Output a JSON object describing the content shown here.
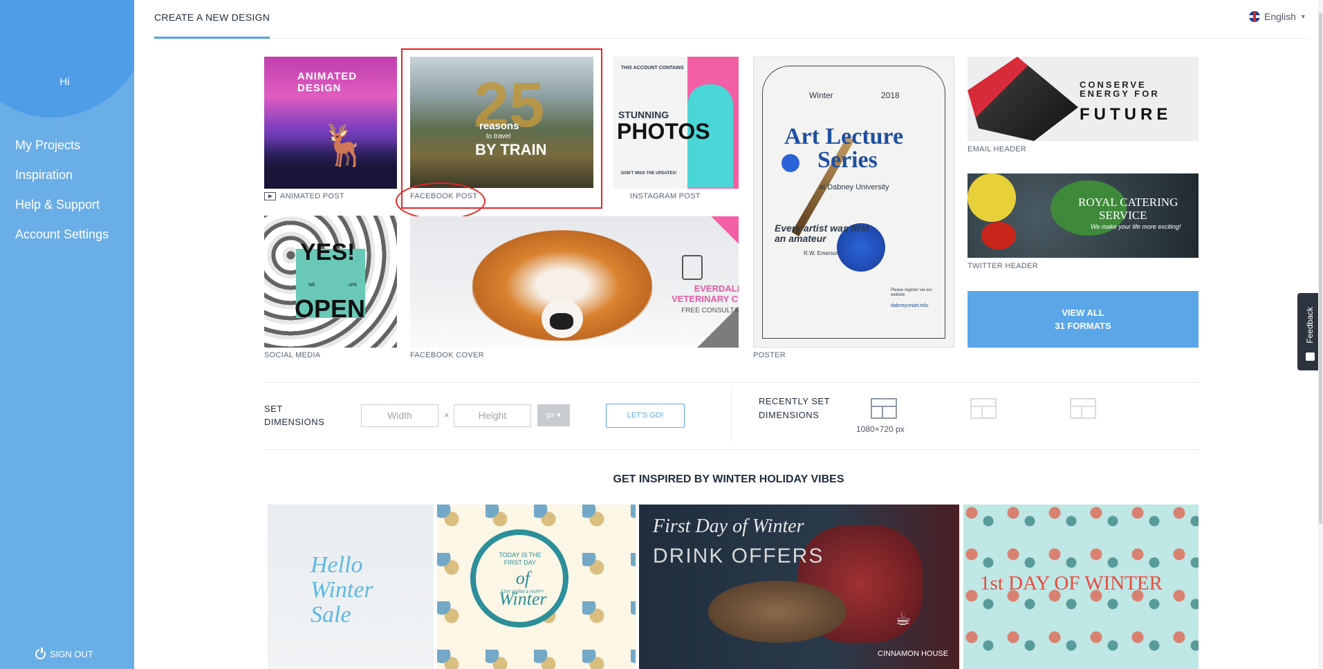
{
  "sidebar": {
    "greeting": "Hi",
    "nav": [
      "My Projects",
      "Inspiration",
      "Help & Support",
      "Account Settings"
    ],
    "sign_out": "SIGN OUT"
  },
  "header": {
    "title": "CREATE A NEW DESIGN",
    "language": "English"
  },
  "formats": {
    "animated_post": {
      "label": "ANIMATED POST",
      "art_text": "ANIMATED DESIGN"
    },
    "facebook_post": {
      "label": "FACEBOOK POST",
      "number": "25",
      "line1": "reasons",
      "line2": "to travel",
      "line3": "BY TRAIN"
    },
    "instagram_post": {
      "label": "INSTAGRAM POST",
      "small": "THIS ACCOUNT CONTAINS",
      "line1": "STUNNING",
      "line2": "PHOTOS",
      "footer": "DON'T MISS THE UPDATES!"
    },
    "poster": {
      "label": "POSTER",
      "winter": "Winter",
      "year": "2018",
      "title1": "Art Lecture",
      "title2": "Series",
      "venue": "at Dabney University",
      "quote": "Every artist was first an amateur",
      "author": "R.W. Emerson",
      "note": "Please register via our website",
      "url": "dabneyuniart.edu"
    },
    "email_header": {
      "label": "EMAIL HEADER",
      "line1": "CONSERVE ENERGY FOR",
      "line2": "FUTURE"
    },
    "twitter_header": {
      "label": "TWITTER HEADER",
      "line1": "ROYAL CATERING",
      "line2": "SERVICE",
      "line3": "We make your life more exciting!"
    },
    "social_media": {
      "label": "SOCIAL MEDIA",
      "line1": "YES!",
      "we": "WE",
      "are": "ARE",
      "line2": "OPEN"
    },
    "facebook_cover": {
      "label": "FACEBOOK COVER",
      "line1": "EVERDALE",
      "line2": "VETERINARY CLINIC",
      "line3": "FREE CONSULTATION"
    },
    "view_all": {
      "line1": "VIEW ALL",
      "line2": "31 FORMATS"
    }
  },
  "dimensions": {
    "label": "SET DIMENSIONS",
    "width_placeholder": "Width",
    "height_placeholder": "Height",
    "times": "×",
    "unit": "px ▾",
    "go": "LET'S GO!"
  },
  "recent": {
    "label": "RECENTLY SET DIMENSIONS",
    "item": "1080×720 px"
  },
  "inspiration": {
    "title": "GET INSPIRED BY WINTER HOLIDAY VIBES",
    "cards": {
      "hello_winter": "Hello Winter Sale",
      "first_day": {
        "line1": "TODAY IS THE FIRST DAY",
        "line2": "of Winter",
        "line3": "STAY WARM & HAPPY"
      },
      "drink": {
        "line1": "First Day of Winter",
        "line2": "DRINK OFFERS",
        "brand": "CINNAMON HOUSE"
      },
      "first_day_winter": "1st DAY OF WINTER"
    }
  },
  "feedback": "Feedback"
}
